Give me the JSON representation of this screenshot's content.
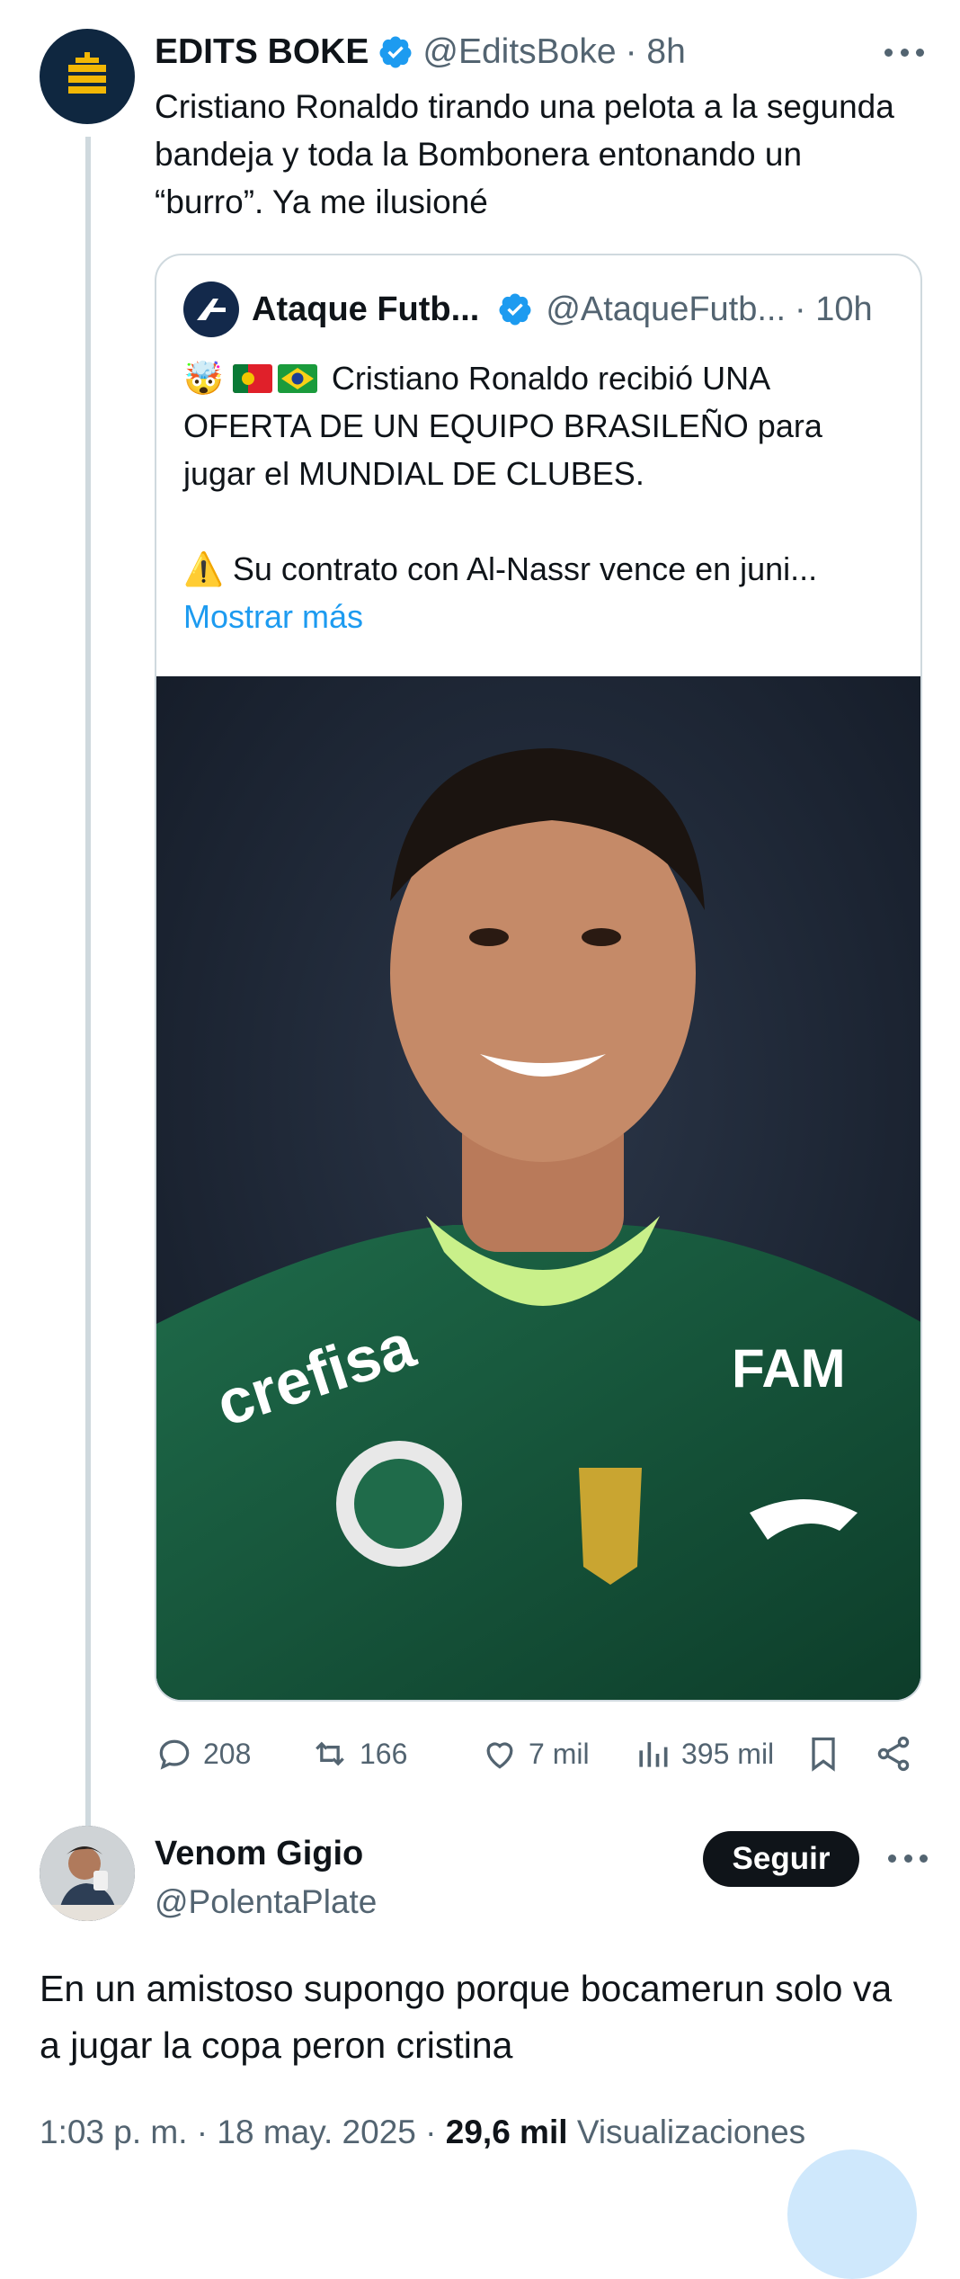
{
  "main_tweet": {
    "display_name": "EDITS BOKE",
    "handle": "@EditsBoke",
    "time": "· 8h",
    "text": "Cristiano Ronaldo tirando una pelota a la segunda bandeja y toda la Bombonera entonando un “burro”. Ya me ilusioné"
  },
  "quoted_tweet": {
    "display_name": "Ataque Futb...",
    "handle": "@AtaqueFutb...",
    "time": "· 10h",
    "emoji_prefix": "🤯",
    "line1": "Cristiano Ronaldo recibió UNA OFERTA DE UN EQUIPO BRASILEÑO para jugar el MUNDIAL DE CLUBES.",
    "warning_emoji": "⚠️",
    "line2": "Su contrato con Al-Nassr vence en juni...",
    "show_more": "Mostrar más"
  },
  "actions": {
    "replies": "208",
    "retweets": "166",
    "likes": "7 mil",
    "views": "395 mil"
  },
  "reply": {
    "display_name": "Venom Gigio",
    "handle": "@PolentaPlate",
    "follow_label": "Seguir",
    "text": "En un amistoso supongo porque bocamerun solo va a jugar la copa peron cristina",
    "time": "1:03 p. m. · 18 may. 2025 ·",
    "views_count": "29,6 mil",
    "views_label": "Visualizaciones"
  },
  "colors": {
    "link": "#1d9bf0",
    "muted": "#536471",
    "verified": "#1d9bf0",
    "avatar_bg": "#0f2740",
    "logo_gold": "#f2b705"
  }
}
